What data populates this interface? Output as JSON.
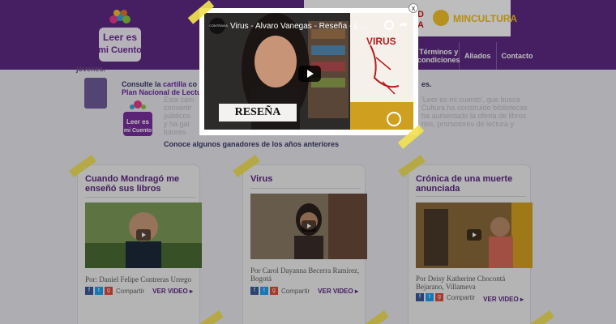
{
  "header": {
    "logo_text": "Leer es mi Cuento",
    "gov_partial": "D",
    "gov_partial2": "A",
    "mincultura": "MINCULTURA",
    "nav": [
      "Términos y condiciones",
      "Aliados",
      "Contacto"
    ]
  },
  "intro": {
    "left_word": "jóvenes.",
    "consult": "Consulte la ",
    "cartilla": "cartilla",
    "consult_tail": " co",
    "plan": "Plan Nacional de Lectu",
    "para": [
      "Esta cam",
      "convertir",
      "públicos",
      "y ha gar",
      "tutores"
    ],
    "right_heading": "es.",
    "right_para": [
      "'Leer es mi cuento', que busca",
      "Cultura ha construido bibliotecas",
      "ha aumentado la oferta de libros",
      "rios, promotores de lectura y"
    ],
    "winners": "Conoce algunos ganadores de los años anteriores"
  },
  "cards": [
    {
      "title": "Cuando Mondragó me enseñó sus libros",
      "byline": "Por: Daniel Felipe Contreras Urrego",
      "share": "Compartir",
      "more": "VER VIDEO"
    },
    {
      "title": "Virus",
      "byline": "Por Carol Dayanna Becerra Ramírez, Bogotá",
      "share": "Compartir",
      "more": "VER VIDEO"
    },
    {
      "title": "Crónica de una muerte anunciada",
      "byline": "Por Deisy Katherine Chocontá Bejarano, Villameva",
      "share": "Compartir",
      "more": "VER VIDEO"
    }
  ],
  "modal": {
    "video_title": "Virus - Alvaro Vanegas - Reseña - Lee...",
    "badge": "RESEÑA",
    "book_title": "VIRUS",
    "close": "x",
    "channel": "CONTRAVIA"
  },
  "colors": {
    "purple": "#5d2a82",
    "accent": "#f3bd19",
    "tape": "#f2e250"
  }
}
